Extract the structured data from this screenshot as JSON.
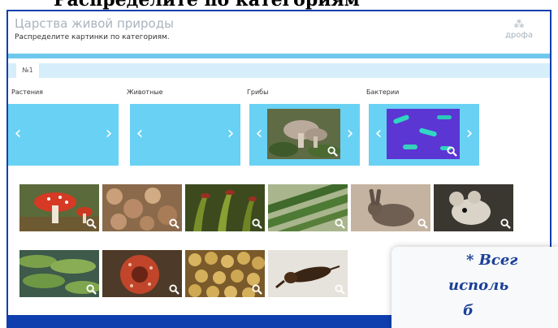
{
  "top_caption": "Распределите по категориям",
  "header": {
    "title": "Царства живой природы",
    "subtitle": "Распределите картинки по категориям.",
    "logo": "дрофа"
  },
  "tabs": [
    "№1"
  ],
  "categories": [
    {
      "label": "Растения",
      "image": "empty"
    },
    {
      "label": "Животные",
      "image": "empty"
    },
    {
      "label": "Грибы",
      "image": "mushroom"
    },
    {
      "label": "Бактерии",
      "image": "bacteria"
    }
  ],
  "icons": {
    "prev": "chevron-left-icon",
    "next": "chevron-right-icon",
    "zoom": "zoom-in-icon"
  },
  "gallery": {
    "row1": [
      "fly-agaric",
      "coral-algae",
      "sundew",
      "spirogyra",
      "hare",
      "mouse"
    ],
    "row2": [
      "water-lily",
      "rafflesia",
      "yeast",
      "mole-cricket"
    ]
  },
  "note": {
    "line1": "* Всег",
    "line2": "исполь",
    "line3": "б"
  },
  "colors": {
    "frame": "#0f3fae",
    "category_box": "#69d1f4",
    "strip": "#6ec8ec",
    "tab_bar": "#d6eefa",
    "note_text": "#1b3f98"
  }
}
